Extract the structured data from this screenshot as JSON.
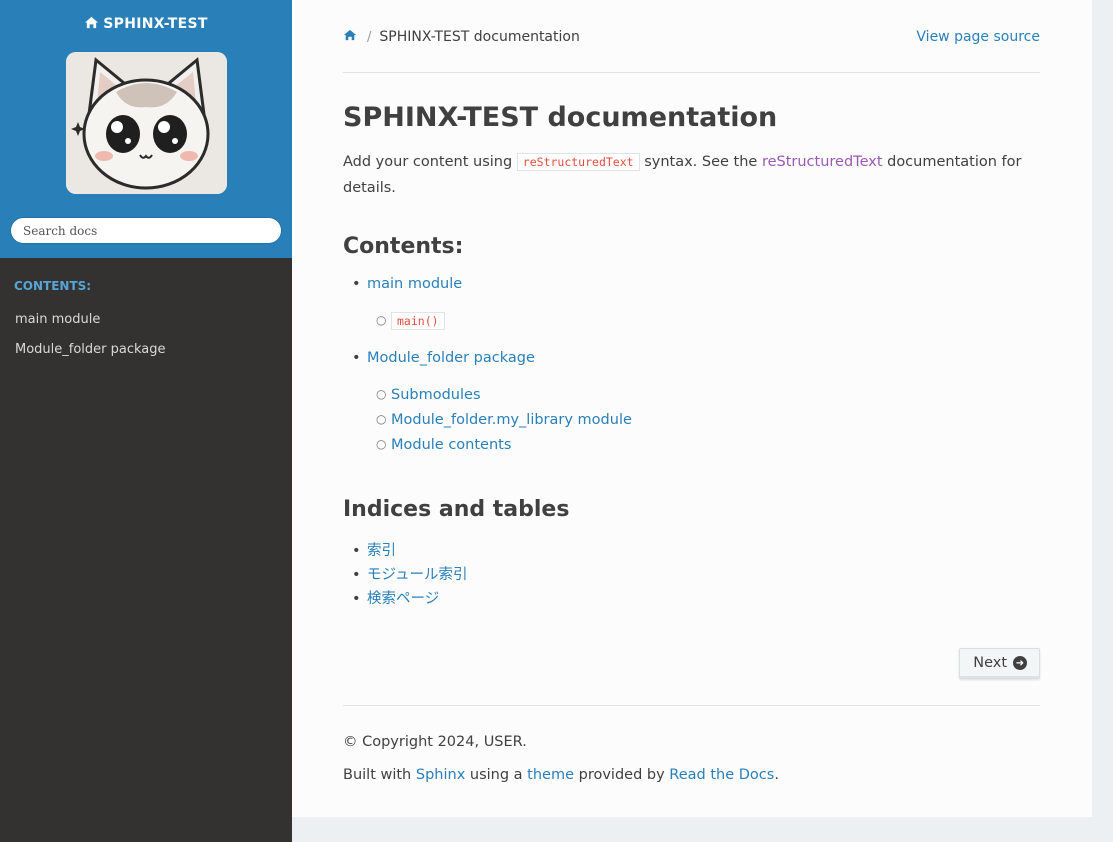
{
  "sidebar": {
    "project_name": "SPHINX-TEST",
    "logo_alt": "logo",
    "search_placeholder": "Search docs",
    "caption": "CONTENTS:",
    "items": [
      {
        "label": "main module"
      },
      {
        "label": "Module_folder package"
      }
    ]
  },
  "breadcrumb": {
    "current": "SPHINX-TEST documentation",
    "separator": "/",
    "view_source": "View page source"
  },
  "main": {
    "title": "SPHINX-TEST documentation",
    "intro_prefix": "Add your content using",
    "intro_code": "reStructuredText",
    "intro_mid": "syntax. See the",
    "intro_link": "reStructuredText",
    "intro_suffix": "documentation for details.",
    "contents_heading": "Contents:",
    "toc": [
      {
        "label": "main module",
        "children": [
          {
            "label": "main()",
            "code": true
          }
        ]
      },
      {
        "label": "Module_folder package",
        "children": [
          {
            "label": "Submodules"
          },
          {
            "label": "Module_folder.my_library module"
          },
          {
            "label": "Module contents"
          }
        ]
      }
    ],
    "indices_heading": "Indices and tables",
    "indices": [
      {
        "label": "索引"
      },
      {
        "label": "モジュール索引"
      },
      {
        "label": "検索ページ"
      }
    ],
    "next_label": "Next"
  },
  "footer": {
    "copyright": "© Copyright 2024, USER.",
    "built_with": "Built with",
    "sphinx": "Sphinx",
    "using_a": "using a",
    "theme": "theme",
    "provided_by": "provided by",
    "rtd": "Read the Docs",
    "period": "."
  },
  "colors": {
    "sidebar_top": "#2980b9",
    "sidebar_bg": "#343131",
    "link": "#2980b9",
    "visited_link": "#9b59b6",
    "code": "#e74c3c"
  },
  "icons": {
    "brand": "home-icon",
    "breadcrumb_home": "home-icon",
    "next": "circle-arrow-right-icon"
  }
}
